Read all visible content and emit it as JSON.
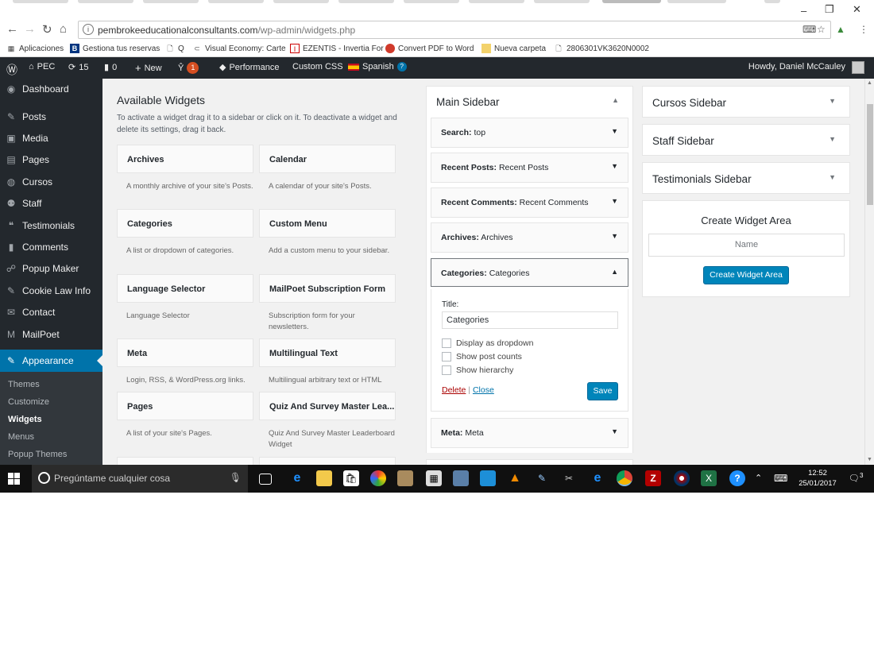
{
  "browser": {
    "url_host": "pembrokeeducationalconsultants.com",
    "url_path": "/wp-admin/widgets.php",
    "bookmarks": [
      {
        "icon": "apps-grid-icon",
        "label": "Aplicaciones"
      },
      {
        "icon": "b-booking-icon",
        "label": "Gestiona tus reservas"
      },
      {
        "icon": "page-icon",
        "label": "Q"
      },
      {
        "icon": "visual-economy-icon",
        "label": "Visual Economy: Carte"
      },
      {
        "icon": "ezentis-icon",
        "label": "EZENTIS - Invertia For"
      },
      {
        "icon": "pdf-icon",
        "label": "Convert PDF to Word"
      },
      {
        "icon": "folder-icon",
        "label": "Nueva carpeta"
      },
      {
        "icon": "page-icon",
        "label": "2806301VK3620N0002"
      }
    ]
  },
  "adminbar": {
    "site": "PEC",
    "updates": "15",
    "comments": "0",
    "new": "New",
    "yoast_badge": "1",
    "performance": "Performance",
    "custom_css": "Custom CSS",
    "language": "Spanish",
    "howdy": "Howdy, Daniel McCauley"
  },
  "menu": {
    "items": [
      {
        "icon": "dashboard-icon",
        "label": "Dashboard"
      },
      {
        "icon": "pin-icon",
        "label": "Posts"
      },
      {
        "icon": "media-icon",
        "label": "Media"
      },
      {
        "icon": "pages-icon",
        "label": "Pages"
      },
      {
        "icon": "globe-icon",
        "label": "Cursos"
      },
      {
        "icon": "staff-icon",
        "label": "Staff"
      },
      {
        "icon": "quote-icon",
        "label": "Testimonials"
      },
      {
        "icon": "comments-icon",
        "label": "Comments"
      },
      {
        "icon": "popup-icon",
        "label": "Popup Maker"
      },
      {
        "icon": "pin-icon",
        "label": "Cookie Law Info"
      },
      {
        "icon": "mail-icon",
        "label": "Contact"
      },
      {
        "icon": "mailpoet-icon",
        "label": "MailPoet"
      }
    ],
    "current": {
      "icon": "appearance-icon",
      "label": "Appearance"
    },
    "submenu": [
      "Themes",
      "Customize",
      "Widgets",
      "Menus",
      "Popup Themes"
    ]
  },
  "available": {
    "title": "Available Widgets",
    "description": "To activate a widget drag it to a sidebar or click on it. To deactivate a widget and delete its settings, drag it back.",
    "widgets": [
      {
        "name": "Archives",
        "desc": "A monthly archive of your site's Posts."
      },
      {
        "name": "Calendar",
        "desc": "A calendar of your site's Posts."
      },
      {
        "name": "Categories",
        "desc": "A list or dropdown of categories."
      },
      {
        "name": "Custom Menu",
        "desc": "Add a custom menu to your sidebar."
      },
      {
        "name": "Language Selector",
        "desc": "Language Selector"
      },
      {
        "name": "MailPoet Subscription Form",
        "desc": "Subscription form for your newsletters."
      },
      {
        "name": "Meta",
        "desc": "Login, RSS, & WordPress.org links."
      },
      {
        "name": "Multilingual Text",
        "desc": "Multilingual arbitrary text or HTML"
      },
      {
        "name": "Pages",
        "desc": "A list of your site's Pages."
      },
      {
        "name": "Quiz And Survey Master Lea...",
        "desc": "Quiz And Survey Master Leaderboard Widget"
      }
    ]
  },
  "main_sidebar": {
    "title": "Main Sidebar",
    "widgets": [
      {
        "type": "Search:",
        "title": "top"
      },
      {
        "type": "Recent Posts:",
        "title": "Recent Posts"
      },
      {
        "type": "Recent Comments:",
        "title": "Recent Comments"
      },
      {
        "type": "Archives:",
        "title": "Archives"
      },
      {
        "type": "Categories:",
        "title": "Categories"
      },
      {
        "type": "Meta:",
        "title": "Meta"
      }
    ],
    "open_widget": {
      "title_label": "Title:",
      "title_value": "Categories",
      "options": [
        "Display as dropdown",
        "Show post counts",
        "Show hierarchy"
      ],
      "delete": "Delete",
      "separator": "|",
      "close": "Close",
      "save": "Save"
    }
  },
  "other_sidebars": [
    "Cursos Sidebar",
    "Staff Sidebar",
    "Testimonials Sidebar"
  ],
  "create_area": {
    "title": "Create Widget Area",
    "name_placeholder": "Name",
    "button": "Create Widget Area"
  },
  "taskbar": {
    "search_placeholder": "Pregúntame cualquier cosa",
    "time": "12:52",
    "date": "25/01/2017",
    "notifications": "3"
  }
}
